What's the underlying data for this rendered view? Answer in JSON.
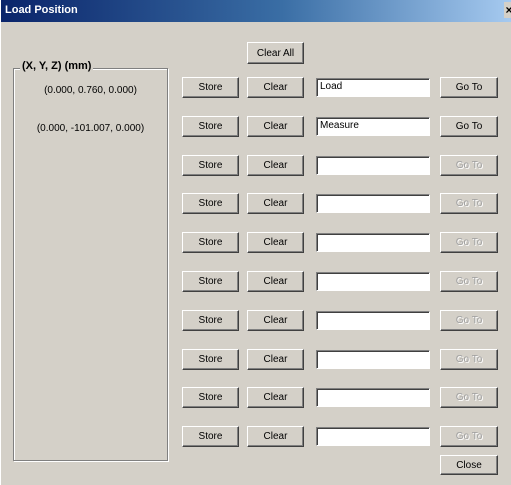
{
  "window": {
    "title": "Load Position",
    "close_glyph": "×"
  },
  "group": {
    "title": "(X, Y, Z) (mm)",
    "coordinates": [
      "(0.000, 0.760, 0.000)",
      "(0.000, -101.007, 0.000)"
    ]
  },
  "clear_all_label": "Clear All",
  "close_label": "Close",
  "rows": [
    {
      "store": "Store",
      "clear": "Clear",
      "name": "Load",
      "goto": "Go To",
      "goto_enabled": true
    },
    {
      "store": "Store",
      "clear": "Clear",
      "name": "Measure",
      "goto": "Go To",
      "goto_enabled": true
    },
    {
      "store": "Store",
      "clear": "Clear",
      "name": "",
      "goto": "Go To",
      "goto_enabled": false
    },
    {
      "store": "Store",
      "clear": "Clear",
      "name": "",
      "goto": "Go To",
      "goto_enabled": false
    },
    {
      "store": "Store",
      "clear": "Clear",
      "name": "",
      "goto": "Go To",
      "goto_enabled": false
    },
    {
      "store": "Store",
      "clear": "Clear",
      "name": "",
      "goto": "Go To",
      "goto_enabled": false
    },
    {
      "store": "Store",
      "clear": "Clear",
      "name": "",
      "goto": "Go To",
      "goto_enabled": false
    },
    {
      "store": "Store",
      "clear": "Clear",
      "name": "",
      "goto": "Go To",
      "goto_enabled": false
    },
    {
      "store": "Store",
      "clear": "Clear",
      "name": "",
      "goto": "Go To",
      "goto_enabled": false
    },
    {
      "store": "Store",
      "clear": "Clear",
      "name": "",
      "goto": "Go To",
      "goto_enabled": false
    }
  ]
}
